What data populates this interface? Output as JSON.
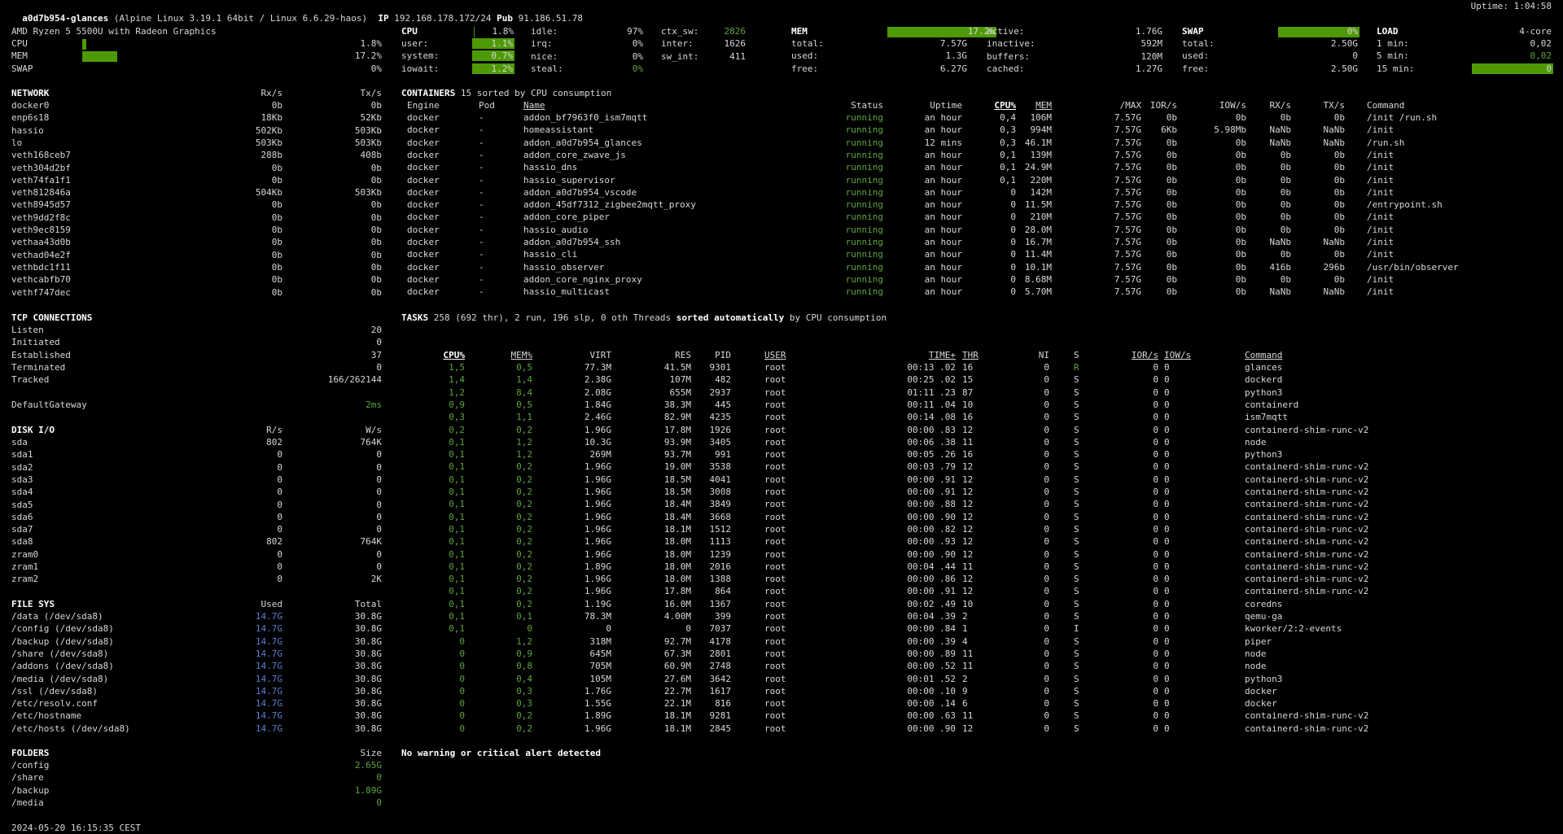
{
  "header": {
    "hostname": "a0d7b954-glances",
    "os": "(Alpine Linux 3.19.1 64bit / Linux 6.6.29-haos)",
    "ip_label": "IP",
    "ip": "192.168.178.172/24",
    "pub_label": "Pub",
    "pub": "91.186.51.78",
    "uptime": "Uptime: 1:04:58"
  },
  "quicklook": {
    "cpu_name": "AMD Ryzen 5 5500U with Radeon Graphics",
    "rows": [
      {
        "label": "CPU",
        "value": "1.8%",
        "fraction": 0.018
      },
      {
        "label": "MEM",
        "value": "17.2%",
        "fraction": 0.172
      },
      {
        "label": "SWAP",
        "value": "0%",
        "fraction": 0
      }
    ]
  },
  "cpu": {
    "title": "CPU",
    "total": "1.8%",
    "total_fraction": 0.018,
    "col1": [
      [
        "user:",
        "1.1%"
      ],
      [
        "system:",
        "0.7%"
      ],
      [
        "iowait:",
        "1.2%"
      ]
    ],
    "col2": [
      [
        "idle:",
        "97%"
      ],
      [
        "irq:",
        "0%"
      ],
      [
        "nice:",
        "0%"
      ],
      [
        "steal:",
        "0%"
      ]
    ],
    "col3": [
      [
        "ctx_sw:",
        "2826"
      ],
      [
        "inter:",
        "1626"
      ],
      [
        "sw_int:",
        "411"
      ]
    ]
  },
  "mem": {
    "title": "MEM",
    "total": "17.2%",
    "total_fraction": 0.172,
    "col1": [
      [
        "total:",
        "7.57G"
      ],
      [
        "used:",
        "1.3G"
      ],
      [
        "free:",
        "6.27G"
      ]
    ],
    "col2": [
      [
        "active:",
        "1.76G"
      ],
      [
        "inactive:",
        "592M"
      ],
      [
        "buffers:",
        "120M"
      ],
      [
        "cached:",
        "1.27G"
      ]
    ]
  },
  "swap": {
    "title": "SWAP",
    "total": "0%",
    "total_fraction": 0,
    "rows": [
      [
        "total:",
        "2.50G"
      ],
      [
        "used:",
        "0"
      ],
      [
        "free:",
        "2.50G"
      ]
    ]
  },
  "load": {
    "title": "LOAD",
    "cores": "4-core",
    "rows": [
      [
        "1 min:",
        "0,02"
      ],
      [
        "5 min:",
        "0,02"
      ],
      [
        "15 min:",
        "0"
      ]
    ]
  },
  "network": {
    "title": "NETWORK",
    "rx": "Rx/s",
    "tx": "Tx/s",
    "rows": [
      [
        "docker0",
        "0b",
        "0b"
      ],
      [
        "enp6s18",
        "18Kb",
        "52Kb"
      ],
      [
        "hassio",
        "502Kb",
        "503Kb"
      ],
      [
        "lo",
        "503Kb",
        "503Kb"
      ],
      [
        "veth168ceb7",
        "288b",
        "408b"
      ],
      [
        "veth304d2bf",
        "0b",
        "0b"
      ],
      [
        "veth74fa1f1",
        "0b",
        "0b"
      ],
      [
        "veth812846a",
        "504Kb",
        "503Kb"
      ],
      [
        "veth8945d57",
        "0b",
        "0b"
      ],
      [
        "veth9dd2f8c",
        "0b",
        "0b"
      ],
      [
        "veth9ec8159",
        "0b",
        "0b"
      ],
      [
        "vethaa43d0b",
        "0b",
        "0b"
      ],
      [
        "vethad04e2f",
        "0b",
        "0b"
      ],
      [
        "vethbdc1f11",
        "0b",
        "0b"
      ],
      [
        "vethcabfb70",
        "0b",
        "0b"
      ],
      [
        "vethf747dec",
        "0b",
        "0b"
      ]
    ]
  },
  "containers": {
    "title": "CONTAINERS",
    "subtitle": "15 sorted by CPU consumption",
    "headers": [
      "Engine",
      "Pod",
      "Name",
      "Status",
      "Uptime",
      "CPU%",
      "MEM",
      "/MAX",
      "IOR/s",
      "IOW/s",
      "RX/s",
      "TX/s",
      "Command"
    ],
    "rows": [
      [
        "docker",
        "-",
        "addon_bf7963f0_ism7mqtt",
        "running",
        "an hour",
        "0,4",
        "106M",
        "7.57G",
        "0b",
        "0b",
        "0b",
        "0b",
        "/init /run.sh"
      ],
      [
        "docker",
        "-",
        "homeassistant",
        "running",
        "an hour",
        "0,3",
        "994M",
        "7.57G",
        "6Kb",
        "5.98Mb",
        "NaNb",
        "NaNb",
        "/init"
      ],
      [
        "docker",
        "-",
        "addon_a0d7b954_glances",
        "running",
        "12 mins",
        "0,3",
        "46.1M",
        "7.57G",
        "0b",
        "0b",
        "NaNb",
        "NaNb",
        "/run.sh"
      ],
      [
        "docker",
        "-",
        "addon_core_zwave_js",
        "running",
        "an hour",
        "0,1",
        "139M",
        "7.57G",
        "0b",
        "0b",
        "0b",
        "0b",
        "/init"
      ],
      [
        "docker",
        "-",
        "hassio_dns",
        "running",
        "an hour",
        "0,1",
        "24.9M",
        "7.57G",
        "0b",
        "0b",
        "0b",
        "0b",
        "/init"
      ],
      [
        "docker",
        "-",
        "hassio_supervisor",
        "running",
        "an hour",
        "0,1",
        "220M",
        "7.57G",
        "0b",
        "0b",
        "0b",
        "0b",
        "/init"
      ],
      [
        "docker",
        "-",
        "addon_a0d7b954_vscode",
        "running",
        "an hour",
        "0",
        "142M",
        "7.57G",
        "0b",
        "0b",
        "0b",
        "0b",
        "/init"
      ],
      [
        "docker",
        "-",
        "addon_45df7312_zigbee2mqtt_proxy",
        "running",
        "an hour",
        "0",
        "11.5M",
        "7.57G",
        "0b",
        "0b",
        "0b",
        "0b",
        "/entrypoint.sh"
      ],
      [
        "docker",
        "-",
        "addon_core_piper",
        "running",
        "an hour",
        "0",
        "210M",
        "7.57G",
        "0b",
        "0b",
        "0b",
        "0b",
        "/init"
      ],
      [
        "docker",
        "-",
        "hassio_audio",
        "running",
        "an hour",
        "0",
        "28.0M",
        "7.57G",
        "0b",
        "0b",
        "0b",
        "0b",
        "/init"
      ],
      [
        "docker",
        "-",
        "addon_a0d7b954_ssh",
        "running",
        "an hour",
        "0",
        "16.7M",
        "7.57G",
        "0b",
        "0b",
        "NaNb",
        "NaNb",
        "/init"
      ],
      [
        "docker",
        "-",
        "hassio_cli",
        "running",
        "an hour",
        "0",
        "11.4M",
        "7.57G",
        "0b",
        "0b",
        "0b",
        "0b",
        "/init"
      ],
      [
        "docker",
        "-",
        "hassio_observer",
        "running",
        "an hour",
        "0",
        "10.1M",
        "7.57G",
        "0b",
        "0b",
        "416b",
        "296b",
        "/usr/bin/observer"
      ],
      [
        "docker",
        "-",
        "addon_core_nginx_proxy",
        "running",
        "an hour",
        "0",
        "8.68M",
        "7.57G",
        "0b",
        "0b",
        "0b",
        "0b",
        "/init"
      ],
      [
        "docker",
        "-",
        "hassio_multicast",
        "running",
        "an hour",
        "0",
        "5.70M",
        "7.57G",
        "0b",
        "0b",
        "NaNb",
        "NaNb",
        "/init"
      ]
    ]
  },
  "tcp": {
    "title": "TCP CONNECTIONS",
    "rows": [
      [
        "Listen",
        "20"
      ],
      [
        "Initiated",
        "0"
      ],
      [
        "Established",
        "37"
      ],
      [
        "Terminated",
        "0"
      ],
      [
        "Tracked",
        "166/262144"
      ]
    ],
    "gateway_label": "DefaultGateway",
    "gateway_value": "2ms"
  },
  "tasks": {
    "title": "TASKS",
    "summary": "258 (692 thr), 2 run, 196 slp, 0 oth Threads",
    "sorted": "sorted automatically",
    "suffix": "by CPU consumption",
    "headers": [
      "CPU%",
      "MEM%",
      "VIRT",
      "RES",
      "PID",
      "USER",
      "TIME+",
      "THR",
      "NI",
      "S",
      "IOR/s",
      "IOW/s",
      "Command"
    ],
    "rows": [
      [
        "1,5",
        "0,5",
        "77.3M",
        "41.5M",
        "9301",
        "root",
        "00:13 .02",
        "16",
        "0",
        "R",
        "0",
        "0",
        "glances"
      ],
      [
        "1,4",
        "1,4",
        "2.38G",
        "107M",
        "482",
        "root",
        "00:25 .02",
        "15",
        "0",
        "S",
        "0",
        "0",
        "dockerd"
      ],
      [
        "1,2",
        "8,4",
        "2.08G",
        "655M",
        "2937",
        "root",
        "01:11 .23",
        "87",
        "0",
        "S",
        "0",
        "0",
        "python3"
      ],
      [
        "0,9",
        "0,5",
        "1.84G",
        "38.3M",
        "445",
        "root",
        "00:11 .04",
        "10",
        "0",
        "S",
        "0",
        "0",
        "containerd"
      ],
      [
        "0,3",
        "1,1",
        "2.46G",
        "82.9M",
        "4235",
        "root",
        "00:14 .08",
        "16",
        "0",
        "S",
        "0",
        "0",
        "ism7mqtt"
      ],
      [
        "0,2",
        "0,2",
        "1.96G",
        "17.8M",
        "1926",
        "root",
        "00:00 .83",
        "12",
        "0",
        "S",
        "0",
        "0",
        "containerd-shim-runc-v2"
      ],
      [
        "0,1",
        "1,2",
        "10.3G",
        "93.9M",
        "3405",
        "root",
        "00:06 .38",
        "11",
        "0",
        "S",
        "0",
        "0",
        "node"
      ],
      [
        "0,1",
        "1,2",
        "269M",
        "93.7M",
        "991",
        "root",
        "00:05 .26",
        "16",
        "0",
        "S",
        "0",
        "0",
        "python3"
      ],
      [
        "0,1",
        "0,2",
        "1.96G",
        "19.0M",
        "3538",
        "root",
        "00:03 .79",
        "12",
        "0",
        "S",
        "0",
        "0",
        "containerd-shim-runc-v2"
      ],
      [
        "0,1",
        "0,2",
        "1.96G",
        "18.5M",
        "4041",
        "root",
        "00:00 .91",
        "12",
        "0",
        "S",
        "0",
        "0",
        "containerd-shim-runc-v2"
      ],
      [
        "0,1",
        "0,2",
        "1.96G",
        "18.5M",
        "3008",
        "root",
        "00:00 .91",
        "12",
        "0",
        "S",
        "0",
        "0",
        "containerd-shim-runc-v2"
      ],
      [
        "0,1",
        "0,2",
        "1.96G",
        "18.4M",
        "3849",
        "root",
        "00:00 .88",
        "12",
        "0",
        "S",
        "0",
        "0",
        "containerd-shim-runc-v2"
      ],
      [
        "0,1",
        "0,2",
        "1.96G",
        "18.4M",
        "3668",
        "root",
        "00:00 .90",
        "12",
        "0",
        "S",
        "0",
        "0",
        "containerd-shim-runc-v2"
      ],
      [
        "0,1",
        "0,2",
        "1.96G",
        "18.1M",
        "1512",
        "root",
        "00:00 .82",
        "12",
        "0",
        "S",
        "0",
        "0",
        "containerd-shim-runc-v2"
      ],
      [
        "0,1",
        "0,2",
        "1.96G",
        "18.0M",
        "1113",
        "root",
        "00:00 .93",
        "12",
        "0",
        "S",
        "0",
        "0",
        "containerd-shim-runc-v2"
      ],
      [
        "0,1",
        "0,2",
        "1.96G",
        "18.0M",
        "1239",
        "root",
        "00:00 .90",
        "12",
        "0",
        "S",
        "0",
        "0",
        "containerd-shim-runc-v2"
      ],
      [
        "0,1",
        "0,2",
        "1.89G",
        "18.0M",
        "2016",
        "root",
        "00:04 .44",
        "11",
        "0",
        "S",
        "0",
        "0",
        "containerd-shim-runc-v2"
      ],
      [
        "0,1",
        "0,2",
        "1.96G",
        "18.0M",
        "1388",
        "root",
        "00:00 .86",
        "12",
        "0",
        "S",
        "0",
        "0",
        "containerd-shim-runc-v2"
      ],
      [
        "0,1",
        "0,2",
        "1.96G",
        "17.8M",
        "864",
        "root",
        "00:00 .91",
        "12",
        "0",
        "S",
        "0",
        "0",
        "containerd-shim-runc-v2"
      ],
      [
        "0,1",
        "0,2",
        "1.19G",
        "16.0M",
        "1367",
        "root",
        "00:02 .49",
        "10",
        "0",
        "S",
        "0",
        "0",
        "coredns"
      ],
      [
        "0,1",
        "0,1",
        "78.3M",
        "4.00M",
        "399",
        "root",
        "00:04 .39",
        "2",
        "0",
        "S",
        "0",
        "0",
        "qemu-ga"
      ],
      [
        "0,1",
        "0",
        "0",
        "0",
        "7037",
        "root",
        "00:00 .84",
        "1",
        "0",
        "I",
        "0",
        "0",
        "kworker/2:2-events"
      ],
      [
        "0",
        "1,2",
        "318M",
        "92.7M",
        "4178",
        "root",
        "00:00 .39",
        "4",
        "0",
        "S",
        "0",
        "0",
        "piper"
      ],
      [
        "0",
        "0,9",
        "645M",
        "67.3M",
        "2801",
        "root",
        "00:00 .89",
        "11",
        "0",
        "S",
        "0",
        "0",
        "node"
      ],
      [
        "0",
        "0,8",
        "705M",
        "60.9M",
        "2748",
        "root",
        "00:00 .52",
        "11",
        "0",
        "S",
        "0",
        "0",
        "node"
      ],
      [
        "0",
        "0,4",
        "105M",
        "27.6M",
        "3642",
        "root",
        "00:01 .52",
        "2",
        "0",
        "S",
        "0",
        "0",
        "python3"
      ],
      [
        "0",
        "0,3",
        "1.76G",
        "22.7M",
        "1617",
        "root",
        "00:00 .10",
        "9",
        "0",
        "S",
        "0",
        "0",
        "docker"
      ],
      [
        "0",
        "0,3",
        "1.55G",
        "22.1M",
        "816",
        "root",
        "00:00 .14",
        "6",
        "0",
        "S",
        "0",
        "0",
        "docker"
      ],
      [
        "0",
        "0,2",
        "1.89G",
        "18.1M",
        "9281",
        "root",
        "00:00 .63",
        "11",
        "0",
        "S",
        "0",
        "0",
        "containerd-shim-runc-v2"
      ],
      [
        "0",
        "0,2",
        "1.96G",
        "18.1M",
        "2845",
        "root",
        "00:00 .90",
        "12",
        "0",
        "S",
        "0",
        "0",
        "containerd-shim-runc-v2"
      ]
    ]
  },
  "diskio": {
    "title": "DISK I/O",
    "r": "R/s",
    "w": "W/s",
    "rows": [
      [
        "sda",
        "802",
        "764K"
      ],
      [
        "sda1",
        "0",
        "0"
      ],
      [
        "sda2",
        "0",
        "0"
      ],
      [
        "sda3",
        "0",
        "0"
      ],
      [
        "sda4",
        "0",
        "0"
      ],
      [
        "sda5",
        "0",
        "0"
      ],
      [
        "sda6",
        "0",
        "0"
      ],
      [
        "sda7",
        "0",
        "0"
      ],
      [
        "sda8",
        "802",
        "764K"
      ],
      [
        "zram0",
        "0",
        "0"
      ],
      [
        "zram1",
        "0",
        "0"
      ],
      [
        "zram2",
        "0",
        "2K"
      ]
    ]
  },
  "fs": {
    "title": "FILE SYS",
    "used": "Used",
    "total": "Total",
    "rows": [
      [
        "/data (/dev/sda8)",
        "14.7G",
        "30.8G"
      ],
      [
        "/config (/dev/sda8)",
        "14.7G",
        "30.8G"
      ],
      [
        "/backup (/dev/sda8)",
        "14.7G",
        "30.8G"
      ],
      [
        "/share (/dev/sda8)",
        "14.7G",
        "30.8G"
      ],
      [
        "/addons (/dev/sda8)",
        "14.7G",
        "30.8G"
      ],
      [
        "/media (/dev/sda8)",
        "14.7G",
        "30.8G"
      ],
      [
        "/ssl (/dev/sda8)",
        "14.7G",
        "30.8G"
      ],
      [
        "/etc/resolv.conf",
        "14.7G",
        "30.8G"
      ],
      [
        "/etc/hostname",
        "14.7G",
        "30.8G"
      ],
      [
        "/etc/hosts (/dev/sda8)",
        "14.7G",
        "30.8G"
      ]
    ]
  },
  "folders": {
    "title": "FOLDERS",
    "size": "Size",
    "rows": [
      [
        "/config",
        "2.65G"
      ],
      [
        "/share",
        "0"
      ],
      [
        "/backup",
        "1.89G"
      ],
      [
        "/media",
        "0"
      ]
    ]
  },
  "alert": "No warning or critical alert detected",
  "footer_time": "2024-05-20 16:15:35 CEST",
  "colors": {
    "bar": "#4e9a06",
    "ok": "#5fa53d",
    "fs_used": "#5b7fd0",
    "bg": "#000000"
  }
}
